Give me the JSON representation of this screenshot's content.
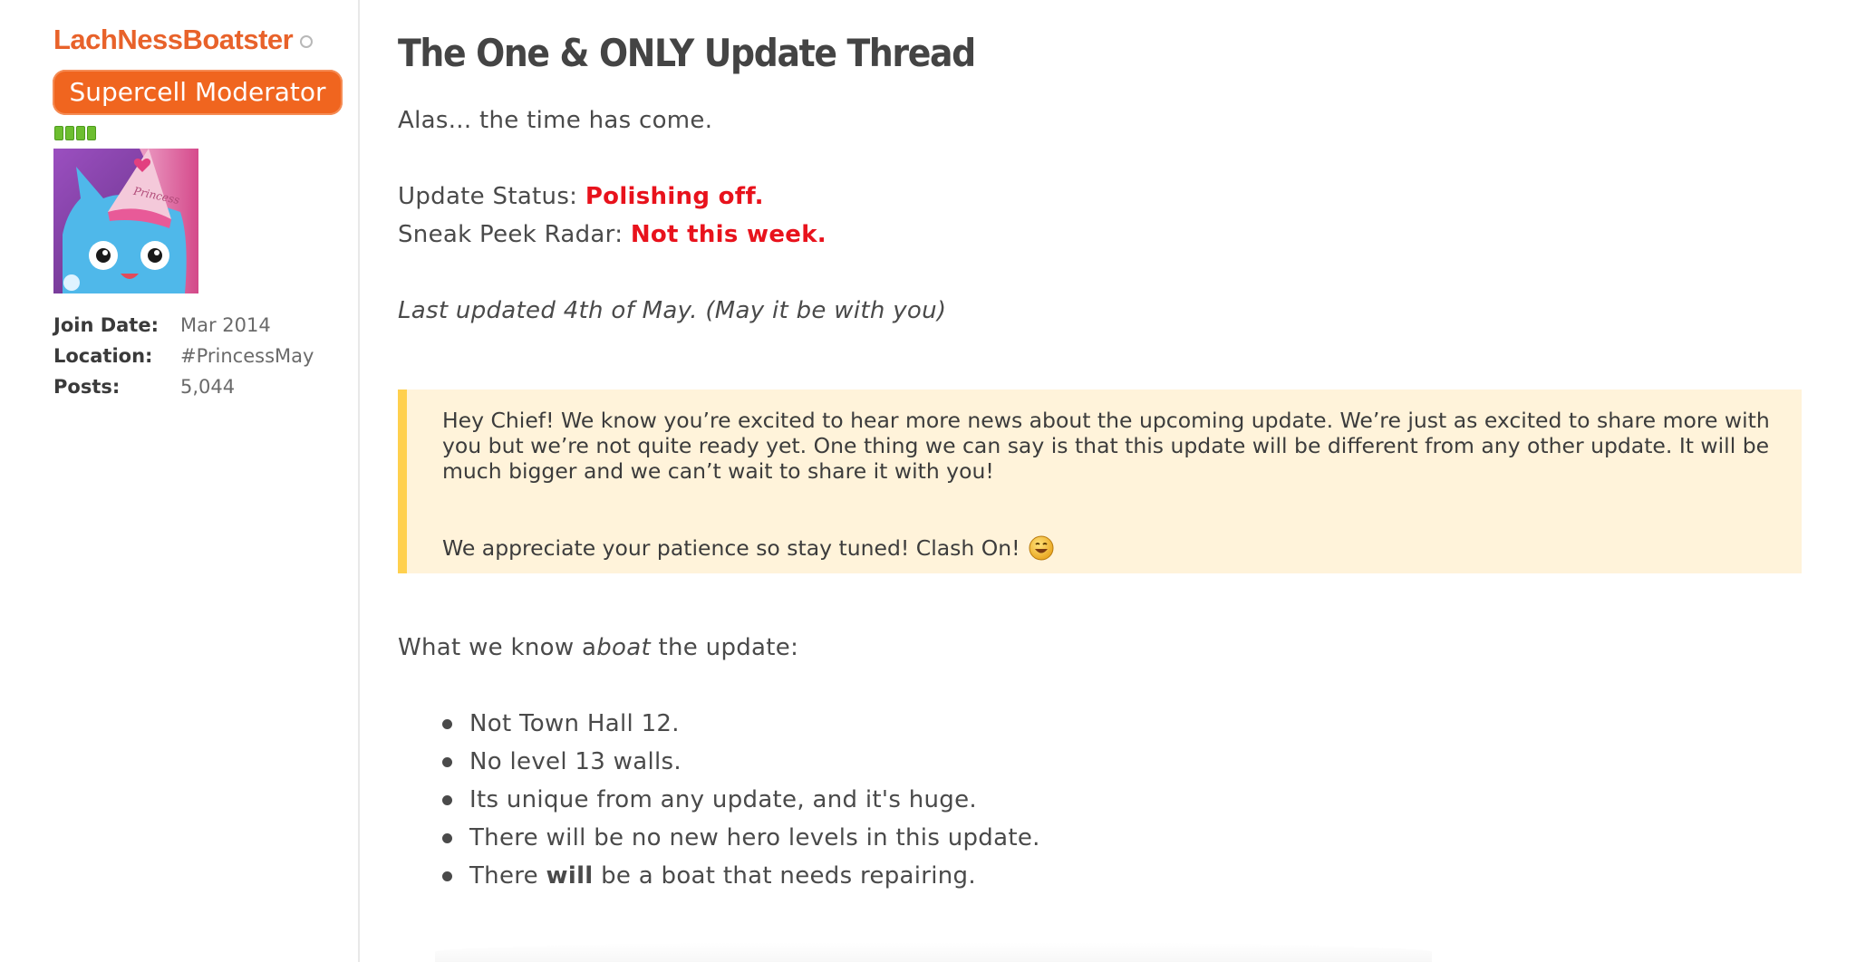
{
  "user": {
    "username": "LachNessBoatster",
    "role": "Supercell Moderator",
    "reputation_pips": 4,
    "avatar_hat_text": "Princess",
    "info": [
      {
        "label": "Join Date:",
        "value": "Mar 2014"
      },
      {
        "label": "Location:",
        "value": "#PrincessMay"
      },
      {
        "label": "Posts:",
        "value": "5,044"
      }
    ]
  },
  "post": {
    "title": "The One & ONLY Update Thread",
    "intro": "Alas... the time has come.",
    "status_label": "Update Status: ",
    "status_value": "Polishing off.",
    "radar_label": "Sneak Peek Radar: ",
    "radar_value": "Not this week.",
    "last_updated": "Last updated 4th of May. (May it be with you)",
    "callout": {
      "paragraph1": "Hey Chief! We know you’re excited to hear more news about the upcoming update. We’re just as excited to share more with you but we’re not quite ready yet. One thing we can say is that this update will be different from any other update. It will be much bigger and we can’t wait to share it with you!",
      "paragraph2": "We appreciate your patience so stay tuned! Clash On!"
    },
    "know_prefix": "What we know a",
    "know_italic": "boat",
    "know_suffix": " the update:",
    "list": [
      {
        "text": "Not Town Hall 12."
      },
      {
        "text": "No level 13 walls."
      },
      {
        "text": "Its unique from any update, and it's huge."
      },
      {
        "text": "There will be no new hero levels in this update."
      },
      {
        "pre": "There ",
        "bold": "will",
        "post": " be a boat that needs repairing."
      }
    ]
  },
  "colors": {
    "username": "#e8622a",
    "badge": "#f0651f",
    "emphasis_red": "#e8121c",
    "callout_bg": "#fff3da",
    "callout_border": "#ffd04e"
  }
}
